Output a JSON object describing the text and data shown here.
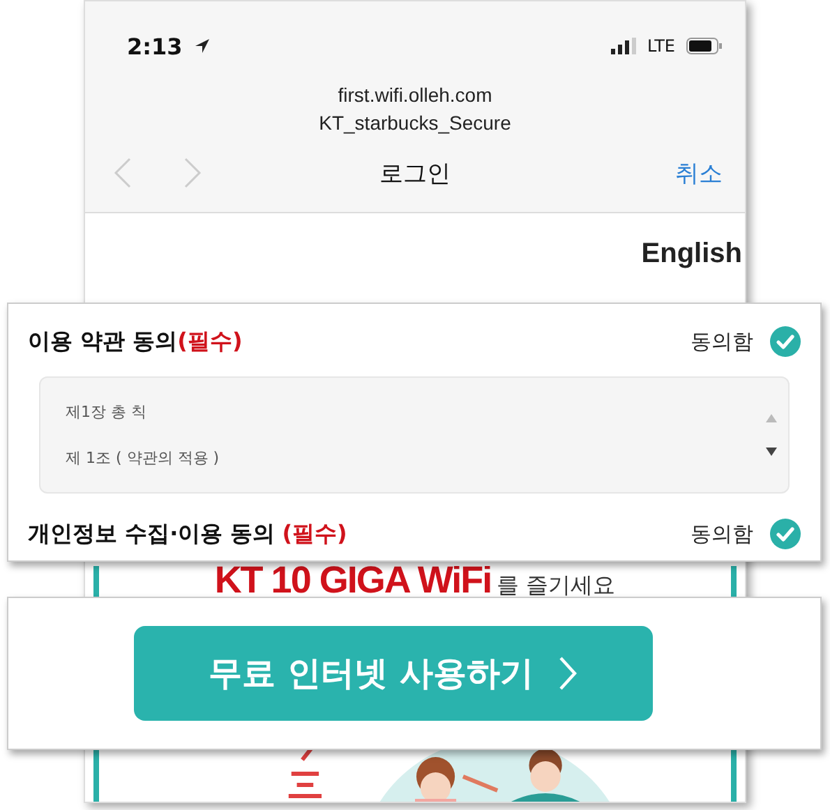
{
  "status_bar": {
    "time": "2:13",
    "network": "LTE"
  },
  "browser": {
    "url": "first.wifi.olleh.com",
    "network_name": "KT_starbucks_Secure",
    "title": "로그인",
    "cancel": "취소"
  },
  "language_link": "English",
  "agreements": [
    {
      "kind": "terms",
      "label": "이용 약관 동의",
      "required": "(필수)",
      "status": "동의함",
      "checked": true,
      "terms_lines": [
        "제1장 총 칙",
        "제 1조 ( 약관의 적용 )"
      ]
    },
    {
      "kind": "plain",
      "label": "개인정보 수집·이용 동의",
      "required": "(필수)",
      "status": "동의함",
      "checked": true
    }
  ],
  "banner": {
    "headline": "KT 10 GIGA WiFi",
    "subtext": "를 즐기세요"
  },
  "cta_button": "무료 인터넷 사용하기"
}
